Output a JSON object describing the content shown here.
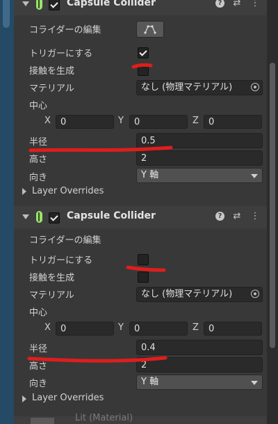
{
  "components": [
    {
      "title": "Capsule Collider",
      "enabled": true,
      "edit_collider_label": "コライダーの編集",
      "is_trigger_label": "トリガーにする",
      "is_trigger": true,
      "provides_contacts_label": "接触を生成",
      "provides_contacts": false,
      "material_label": "マテリアル",
      "material_value": "なし (物理マテリアル)",
      "center_label": "中心",
      "center": {
        "x_label": "X",
        "x": "0",
        "y_label": "Y",
        "y": "0",
        "z_label": "Z",
        "z": "0"
      },
      "radius_label": "半径",
      "radius": "0.5",
      "height_label": "高さ",
      "height": "2",
      "direction_label": "向き",
      "direction": "Y 軸",
      "layer_overrides_label": "Layer Overrides"
    },
    {
      "title": "Capsule Collider",
      "enabled": true,
      "edit_collider_label": "コライダーの編集",
      "is_trigger_label": "トリガーにする",
      "is_trigger": false,
      "provides_contacts_label": "接触を生成",
      "provides_contacts": false,
      "material_label": "マテリアル",
      "material_value": "なし (物理マテリアル)",
      "center_label": "中心",
      "center": {
        "x_label": "X",
        "x": "0",
        "y_label": "Y",
        "y": "0",
        "z_label": "Z",
        "z": "0"
      },
      "radius_label": "半径",
      "radius": "0.4",
      "height_label": "高さ",
      "height": "2",
      "direction_label": "向き",
      "direction": "Y 軸",
      "layer_overrides_label": "Layer Overrides"
    }
  ],
  "next_component_title": "Lit (Material)",
  "icons": {
    "fold": "chevron-down-icon",
    "component": "capsule-collider-icon",
    "help": "help-icon",
    "presets": "presets-icon",
    "menu": "more-menu-icon",
    "edit_collider": "edit-collider-icon",
    "object_picker": "object-picker-icon"
  },
  "colors": {
    "panel_bg": "#383838",
    "field_bg": "#2a2a2a",
    "annotation_red": "#e01d1d"
  }
}
